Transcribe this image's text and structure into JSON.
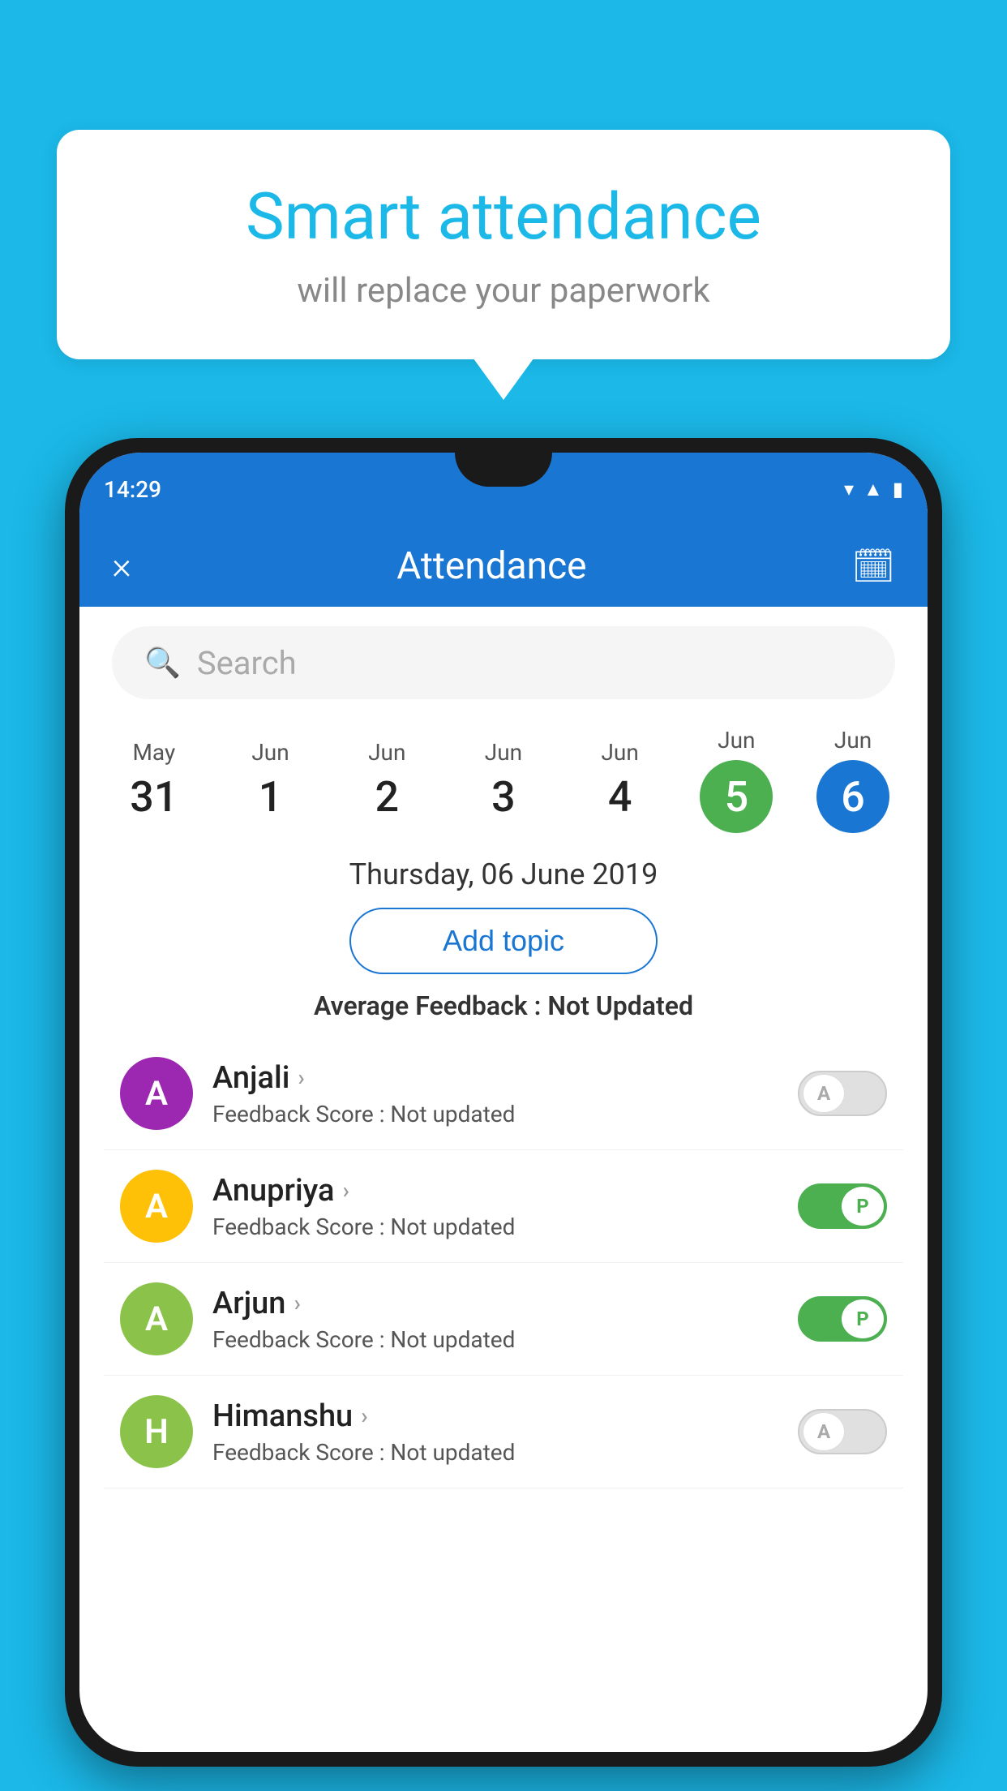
{
  "background_color": "#1bb8e8",
  "bubble": {
    "title": "Smart attendance",
    "subtitle": "will replace your paperwork"
  },
  "phone": {
    "status_bar": {
      "time": "14:29",
      "icons": [
        "wifi",
        "signal",
        "battery"
      ]
    },
    "header": {
      "title": "Attendance",
      "close_label": "×",
      "calendar_icon": "📅"
    },
    "search": {
      "placeholder": "Search"
    },
    "dates": [
      {
        "month": "May",
        "day": "31",
        "selected": false
      },
      {
        "month": "Jun",
        "day": "1",
        "selected": false
      },
      {
        "month": "Jun",
        "day": "2",
        "selected": false
      },
      {
        "month": "Jun",
        "day": "3",
        "selected": false
      },
      {
        "month": "Jun",
        "day": "4",
        "selected": false
      },
      {
        "month": "Jun",
        "day": "5",
        "selected": "green"
      },
      {
        "month": "Jun",
        "day": "6",
        "selected": "blue"
      }
    ],
    "selected_date_label": "Thursday, 06 June 2019",
    "add_topic_label": "Add topic",
    "avg_feedback_label": "Average Feedback : ",
    "avg_feedback_value": "Not Updated",
    "students": [
      {
        "name": "Anjali",
        "initial": "A",
        "avatar_color": "#9c27b0",
        "feedback_label": "Feedback Score : ",
        "feedback_value": "Not updated",
        "status": "absent"
      },
      {
        "name": "Anupriya",
        "initial": "A",
        "avatar_color": "#ffc107",
        "feedback_label": "Feedback Score : ",
        "feedback_value": "Not updated",
        "status": "present"
      },
      {
        "name": "Arjun",
        "initial": "A",
        "avatar_color": "#8bc34a",
        "feedback_label": "Feedback Score : ",
        "feedback_value": "Not updated",
        "status": "present"
      },
      {
        "name": "Himanshu",
        "initial": "H",
        "avatar_color": "#8bc34a",
        "feedback_label": "Feedback Score : ",
        "feedback_value": "Not updated",
        "status": "absent"
      }
    ]
  }
}
